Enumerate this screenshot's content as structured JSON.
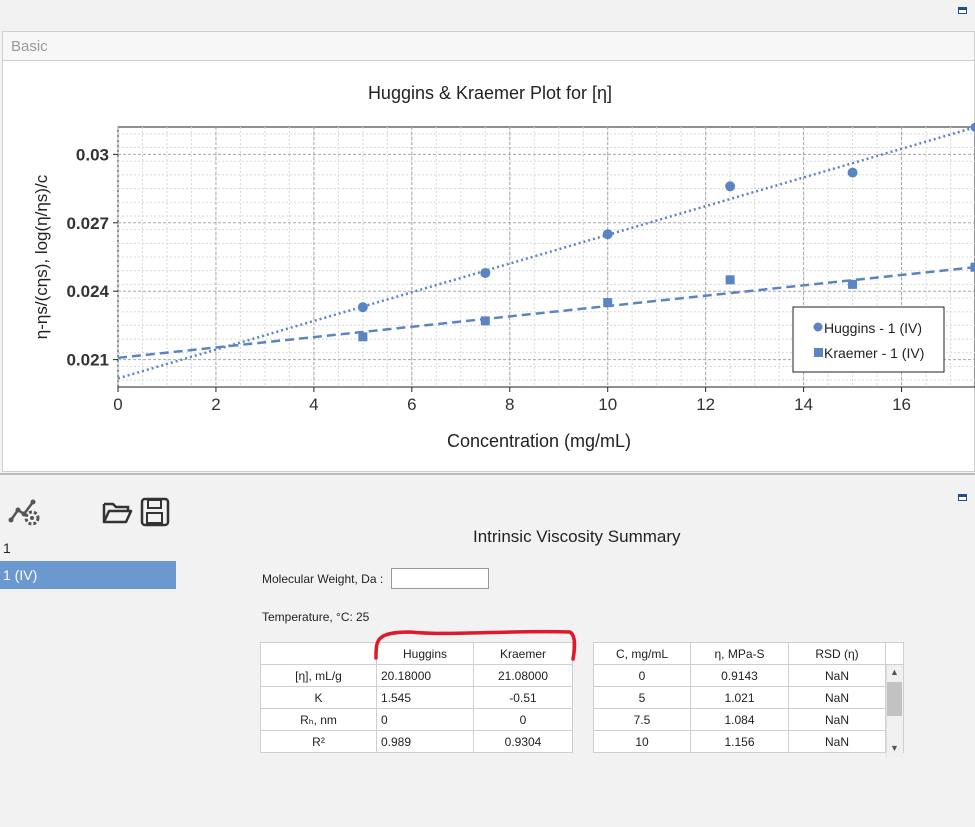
{
  "colors": {
    "series": "#5b84c4",
    "selected": "#6b98cf",
    "annotation": "#e0192a"
  },
  "tab": {
    "label": "Basic"
  },
  "chart_data": {
    "type": "scatter",
    "title": "Huggins & Kraemer Plot for [η]",
    "xlabel": "Concentration (mg/mL)",
    "ylabel": "η-ηs/(cηs), log(η/ηs)/c",
    "xlim": [
      0,
      17.5
    ],
    "ylim": [
      0.0198,
      0.0312
    ],
    "xticks": [
      0,
      2,
      4,
      6,
      8,
      10,
      12,
      14,
      16
    ],
    "yticks": [
      0.021,
      0.024,
      0.027,
      0.03
    ],
    "ytick_labels": [
      "0.021",
      "0.024",
      "0.027",
      "0.03"
    ],
    "grid": true,
    "legend_position": "bottom-right",
    "series": [
      {
        "name": "Huggins - 1 (IV)",
        "marker": "circle",
        "line": "dotted",
        "x": [
          5,
          7.5,
          10,
          12.5,
          15
        ],
        "y": [
          0.0233,
          0.0248,
          0.0265,
          0.0286,
          0.0292
        ],
        "fit": {
          "intercept": 0.02018,
          "slope": 0.000629
        }
      },
      {
        "name": "Kraemer - 1 (IV)",
        "marker": "square",
        "line": "dashed",
        "x": [
          5,
          7.5,
          10,
          12.5,
          15
        ],
        "y": [
          0.022,
          0.0227,
          0.0235,
          0.0245,
          0.0243
        ],
        "fit": {
          "intercept": 0.02108,
          "slope": 0.000227
        }
      }
    ]
  },
  "lower": {
    "list": {
      "item1": "1",
      "item2": "1 (IV)"
    },
    "summary_title": "Intrinsic Viscosity Summary",
    "mw_label": "Molecular Weight, Da :",
    "mw_value": "",
    "temp_label": "Temperature, °C:",
    "temp_value": "25"
  },
  "table1": {
    "headers": [
      "",
      "Huggins",
      "Kraemer"
    ],
    "rows": [
      [
        "[η], mL/g",
        "20.18000",
        "21.08000"
      ],
      [
        "K",
        "1.545",
        "-0.51"
      ],
      [
        "Rₕ, nm",
        "0",
        "0"
      ],
      [
        "R²",
        "0.989",
        "0.9304"
      ]
    ]
  },
  "table2": {
    "headers": [
      "C, mg/mL",
      "η, MPa-S",
      "RSD (η)"
    ],
    "rows": [
      [
        "0",
        "0.9143",
        "NaN"
      ],
      [
        "5",
        "1.021",
        "NaN"
      ],
      [
        "7.5",
        "1.084",
        "NaN"
      ],
      [
        "10",
        "1.156",
        "NaN"
      ]
    ]
  }
}
